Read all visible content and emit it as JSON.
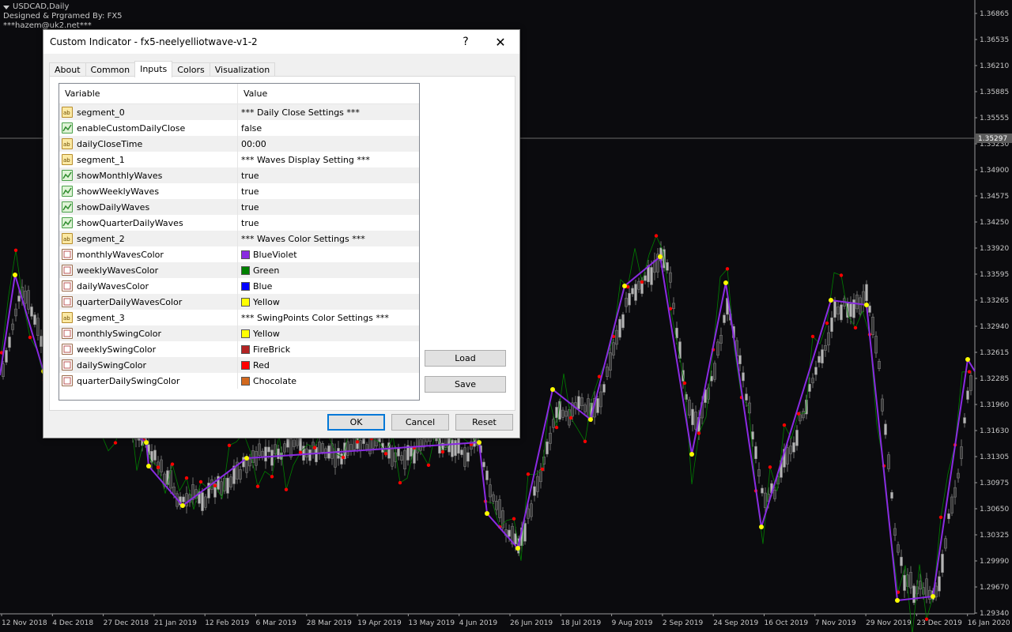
{
  "chart": {
    "symbol": "USDCAD,Daily",
    "credit": "Designed & Prgramed By: FX5",
    "email": "***hazem@uk2.net***",
    "current_price": "1.35297",
    "price_labels": [
      "1.36865",
      "1.36535",
      "1.36210",
      "1.35885",
      "1.35555",
      "1.35230",
      "1.34900",
      "1.34575",
      "1.34250",
      "1.33920",
      "1.33595",
      "1.33265",
      "1.32940",
      "1.32615",
      "1.32285",
      "1.31960",
      "1.31630",
      "1.31305",
      "1.30975",
      "1.30650",
      "1.30325",
      "1.29990",
      "1.29670",
      "1.29340"
    ],
    "date_labels": [
      "12 Nov 2018",
      "4 Dec 2018",
      "27 Dec 2018",
      "21 Jan 2019",
      "12 Feb 2019",
      "6 Mar 2019",
      "28 Mar 2019",
      "19 Apr 2019",
      "13 May 2019",
      "4 Jun 2019",
      "26 Jun 2019",
      "18 Jul 2019",
      "9 Aug 2019",
      "2 Sep 2019",
      "24 Sep 2019",
      "16 Oct 2019",
      "7 Nov 2019",
      "29 Nov 2019",
      "23 Dec 2019",
      "16 Jan 2020"
    ],
    "colors": {
      "background": "#0b0b0e",
      "wave": "#8a2be2",
      "monthly_swing": "#ffff00",
      "daily_swing": "#ff0000",
      "candle": "#8a8a8a",
      "minor_wave": "#008000"
    }
  },
  "dialog": {
    "title": "Custom Indicator - fx5-neelyelliotwave-v1-2",
    "help_label": "?",
    "close_label": "✕",
    "tabs": [
      {
        "label": "About"
      },
      {
        "label": "Common"
      },
      {
        "label": "Inputs"
      },
      {
        "label": "Colors"
      },
      {
        "label": "Visualization"
      }
    ],
    "columns": {
      "variable": "Variable",
      "value": "Value"
    },
    "rows": [
      {
        "icon": "ab",
        "name": "segment_0",
        "value": "*** Daily Close Settings ***"
      },
      {
        "icon": "bool",
        "name": "enableCustomDailyClose",
        "value": "false"
      },
      {
        "icon": "ab",
        "name": "dailyCloseTime",
        "value": "00:00"
      },
      {
        "icon": "ab",
        "name": "segment_1",
        "value": "*** Waves Display Setting ***"
      },
      {
        "icon": "bool",
        "name": "showMonthlyWaves",
        "value": "true"
      },
      {
        "icon": "bool",
        "name": "showWeeklyWaves",
        "value": "true"
      },
      {
        "icon": "bool",
        "name": "showDailyWaves",
        "value": "true"
      },
      {
        "icon": "bool",
        "name": "showQuarterDailyWaves",
        "value": "true"
      },
      {
        "icon": "ab",
        "name": "segment_2",
        "value": "*** Waves Color Settings ***"
      },
      {
        "icon": "color",
        "name": "monthlyWavesColor",
        "value": "BlueViolet",
        "swatch": "#8a2be2"
      },
      {
        "icon": "color",
        "name": "weeklyWavesColor",
        "value": "Green",
        "swatch": "#008000"
      },
      {
        "icon": "color",
        "name": "dailyWavesColor",
        "value": "Blue",
        "swatch": "#0000ff"
      },
      {
        "icon": "color",
        "name": "quarterDailyWavesColor",
        "value": "Yellow",
        "swatch": "#ffff00"
      },
      {
        "icon": "ab",
        "name": "segment_3",
        "value": "*** SwingPoints Color Settings ***"
      },
      {
        "icon": "color",
        "name": "monthlySwingColor",
        "value": "Yellow",
        "swatch": "#ffff00"
      },
      {
        "icon": "color",
        "name": "weeklySwingColor",
        "value": "FireBrick",
        "swatch": "#b22222"
      },
      {
        "icon": "color",
        "name": "dailySwingColor",
        "value": "Red",
        "swatch": "#ff0000"
      },
      {
        "icon": "color",
        "name": "quarterDailySwingColor",
        "value": "Chocolate",
        "swatch": "#d2691e"
      }
    ],
    "buttons": {
      "load": "Load",
      "save": "Save",
      "ok": "OK",
      "cancel": "Cancel",
      "reset": "Reset"
    }
  }
}
